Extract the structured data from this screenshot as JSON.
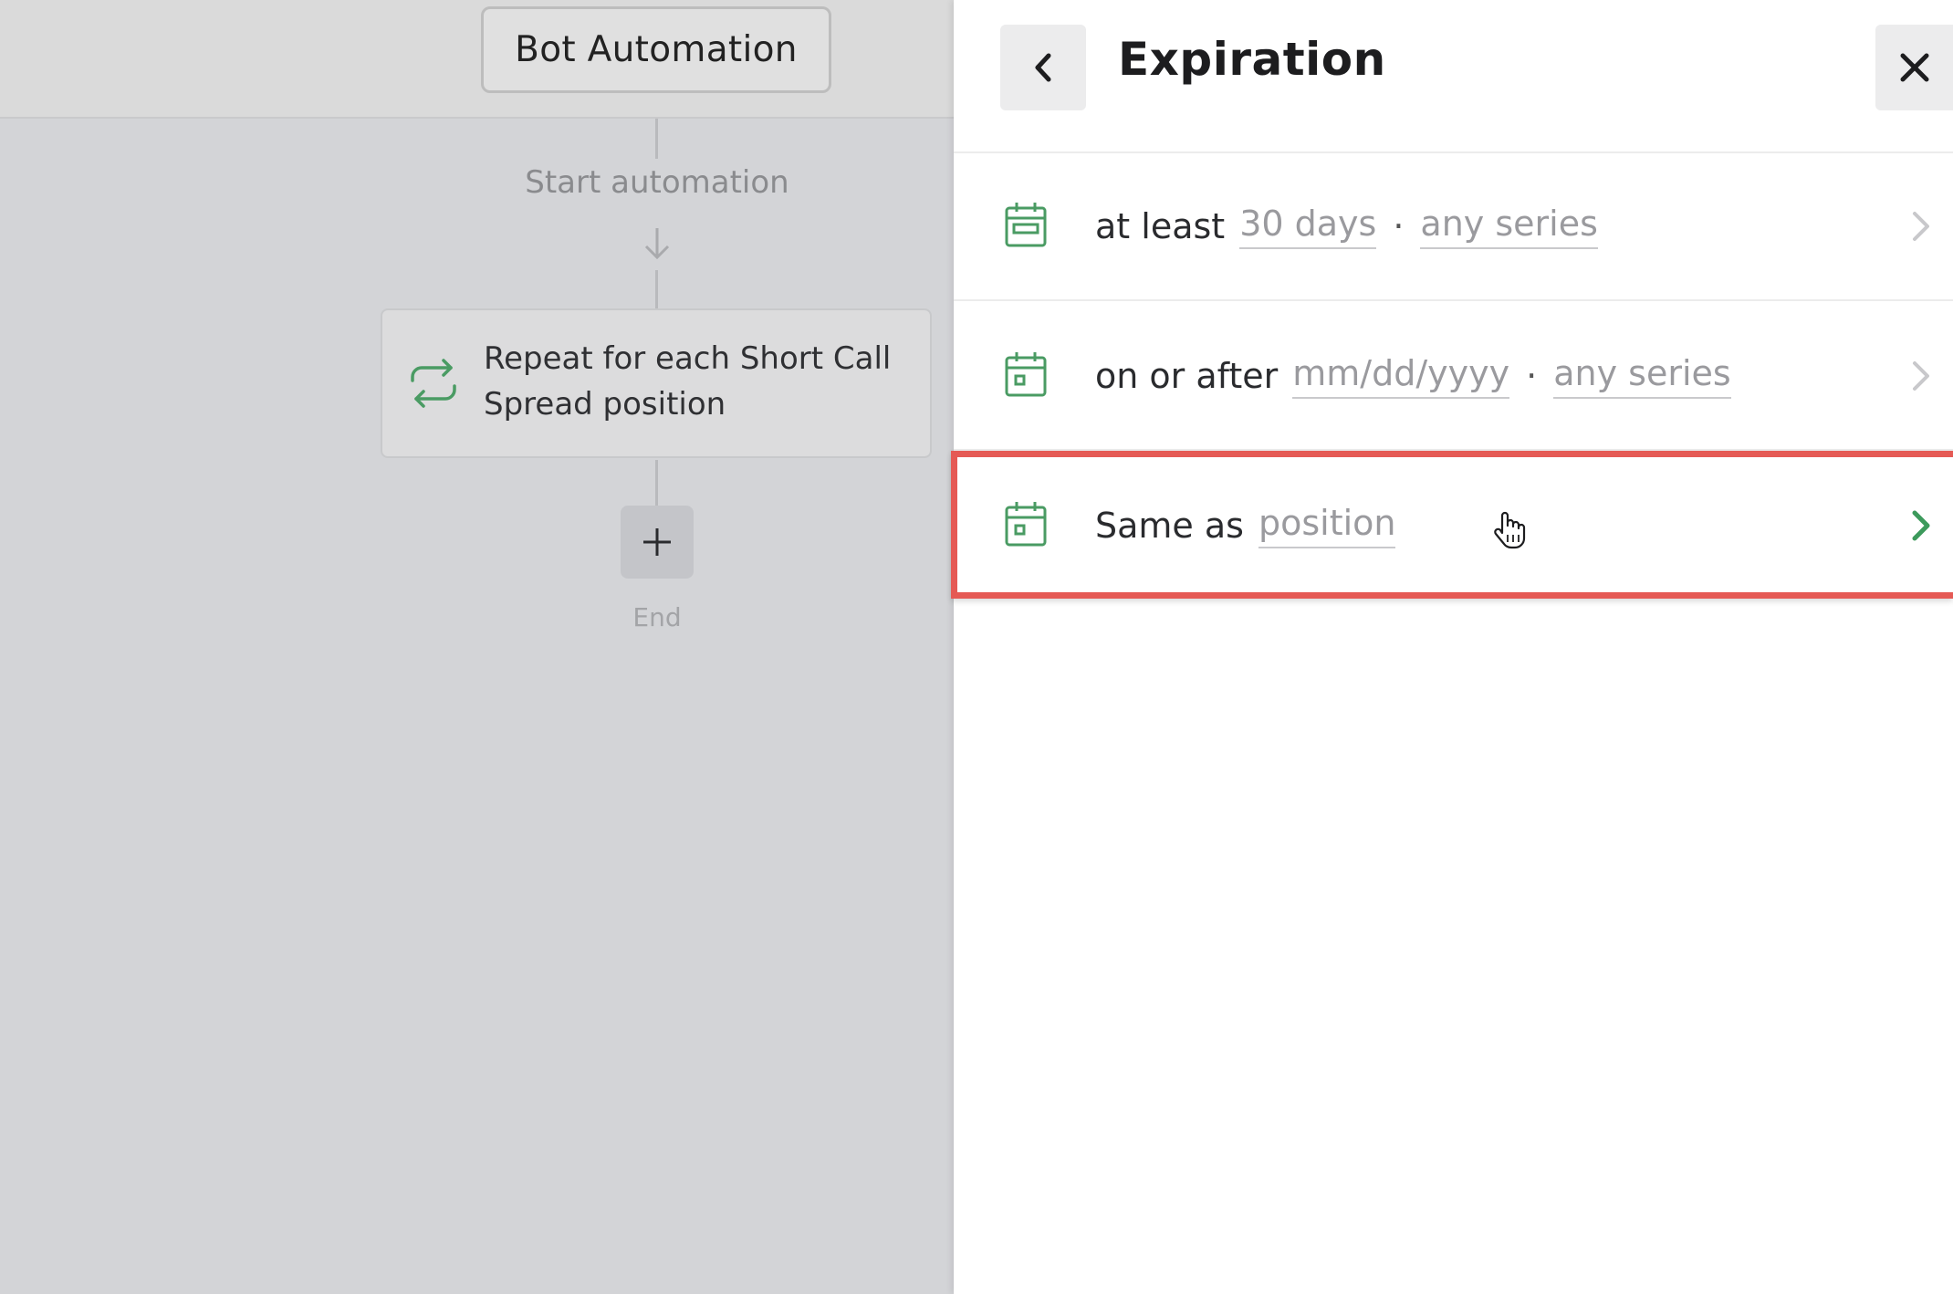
{
  "canvas": {
    "bot_title": "Bot Automation",
    "start_label": "Start automation",
    "repeat_text": "Repeat for each Short Call Spread position",
    "end_label": "End"
  },
  "panel": {
    "title": "Expiration",
    "options": [
      {
        "prefix": "at least",
        "field1": "30 days",
        "separator": "·",
        "field2": "any series",
        "selected": false
      },
      {
        "prefix": "on or after",
        "field1": "mm/dd/yyyy",
        "separator": "·",
        "field2": "any series",
        "selected": false
      },
      {
        "prefix": "Same as",
        "field1": "position",
        "selected": true
      }
    ]
  },
  "colors": {
    "accent_green": "#3d9a5c",
    "highlight_red": "#e55a55"
  },
  "icons": {
    "back": "chevron-left-icon",
    "close": "close-icon",
    "calendar": "calendar-icon",
    "repeat": "repeat-icon",
    "add": "plus-icon",
    "row_chevron": "chevron-right-icon"
  }
}
